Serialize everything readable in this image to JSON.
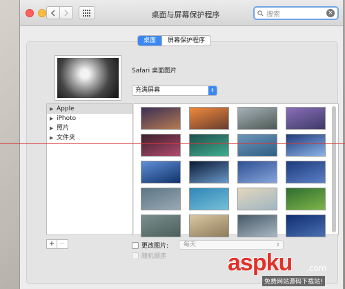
{
  "window": {
    "title": "桌面与屏幕保护程序",
    "search_placeholder": "搜索"
  },
  "tabs": [
    {
      "label": "桌面",
      "active": true
    },
    {
      "label": "屏幕保护程序",
      "active": false
    }
  ],
  "current": {
    "wallpaper_name": "Safari 桌面图片",
    "fill_mode": "充满屏幕"
  },
  "sources": [
    {
      "label": "Apple",
      "selected": true
    },
    {
      "label": "iPhoto",
      "selected": false
    },
    {
      "label": "照片",
      "selected": false
    },
    {
      "label": "文件夹",
      "selected": false
    }
  ],
  "thumbnails": [
    {
      "name": "el-capitan-dusk",
      "c1": "#3b2f55",
      "c2": "#b57a52"
    },
    {
      "name": "el-capitan-sunset",
      "c1": "#f08a3c",
      "c2": "#6a3d2e"
    },
    {
      "name": "yosemite-valley",
      "c1": "#a7b1b7",
      "c2": "#4c5a55"
    },
    {
      "name": "yosemite-purple",
      "c1": "#8a6fb7",
      "c2": "#3e3a69"
    },
    {
      "name": "dark-dunes",
      "c1": "#3a1f2c",
      "c2": "#b24b6e"
    },
    {
      "name": "green-aurora",
      "c1": "#1f4f4d",
      "c2": "#3fae8f"
    },
    {
      "name": "blue-waves",
      "c1": "#6e95b8",
      "c2": "#2f5f86"
    },
    {
      "name": "galaxy",
      "c1": "#203a7a",
      "c2": "#8ab4e8"
    },
    {
      "name": "blue-ripple",
      "c1": "#5e8fd6",
      "c2": "#12336b"
    },
    {
      "name": "earth-horizon",
      "c1": "#0b1a36",
      "c2": "#6a98c7"
    },
    {
      "name": "night-sky",
      "c1": "#2e4f94",
      "c2": "#86a5da"
    },
    {
      "name": "moon-blue",
      "c1": "#1d3b7c",
      "c2": "#5b7fc6"
    },
    {
      "name": "storm-clouds",
      "c1": "#5d7584",
      "c2": "#98a9b3"
    },
    {
      "name": "ocean-aerial",
      "c1": "#2f86b7",
      "c2": "#76bfd8"
    },
    {
      "name": "sand-dunes",
      "c1": "#e2d6bd",
      "c2": "#9fb6c2"
    },
    {
      "name": "green-fields",
      "c1": "#2e6d2e",
      "c2": "#7fb54a"
    },
    {
      "name": "rain-drops",
      "c1": "#7a8e8d",
      "c2": "#4b5f5c"
    },
    {
      "name": "desert-haze",
      "c1": "#d9c6a1",
      "c2": "#8e7c5c"
    },
    {
      "name": "misty-mountain",
      "c1": "#475866",
      "c2": "#a9b8c4"
    },
    {
      "name": "deep-blue",
      "c1": "#0f2e6e",
      "c2": "#4a6fb4"
    }
  ],
  "controls": {
    "add": "+",
    "remove": "−",
    "change_picture_label": "更改图片:",
    "interval": "每天",
    "random_order_label": "随机顺序"
  },
  "watermark": {
    "brand": "aspku",
    "suffix": ".com",
    "tagline": "免费网站源码下载站!"
  }
}
